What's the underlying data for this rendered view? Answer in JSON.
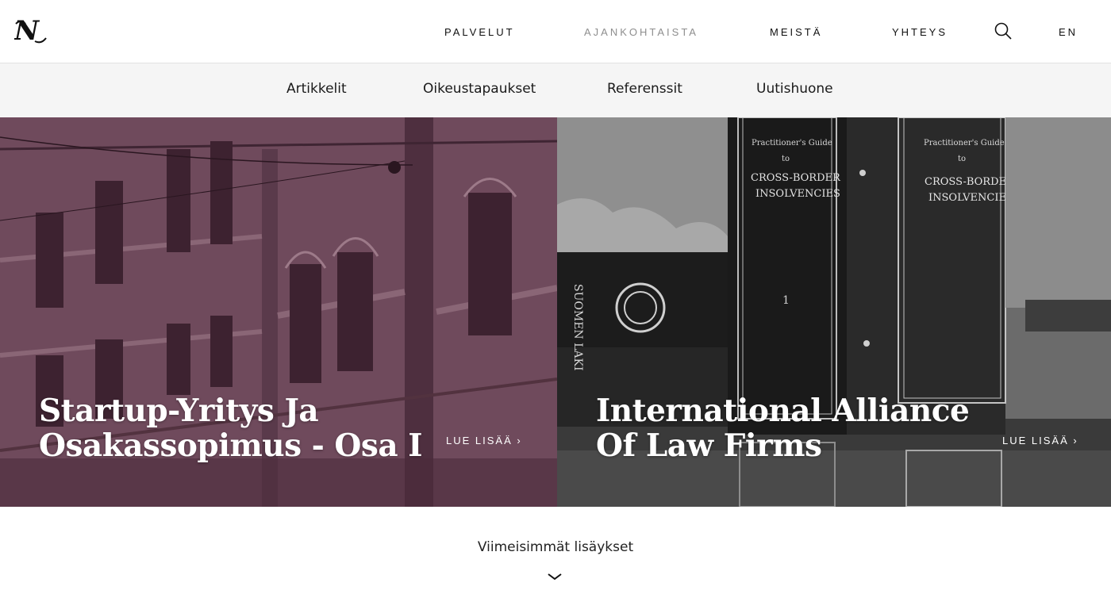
{
  "header": {
    "logo_label": "N",
    "nav": [
      {
        "label": "PALVELUT",
        "active": false
      },
      {
        "label": "AJANKOHTAISTA",
        "active": true
      },
      {
        "label": "MEISTÄ",
        "active": false
      },
      {
        "label": "YHTEYS",
        "active": false
      }
    ],
    "language": "EN",
    "search_icon": "search-icon"
  },
  "subnav": {
    "items": [
      {
        "label": "Artikkelit"
      },
      {
        "label": "Oikeustapaukset"
      },
      {
        "label": "Referenssit"
      },
      {
        "label": "Uutishuone"
      }
    ]
  },
  "hero": {
    "cards": [
      {
        "title_line1": "Startup-Yritys Ja",
        "title_line2": "Osakassopimus - Osa I",
        "read_more": "LUE LISÄÄ ›",
        "overlay_color": "#6a4558"
      },
      {
        "title_line1": "International Alliance",
        "title_line2": "Of Law Firms",
        "read_more": "LUE LISÄÄ ›",
        "book_spine_1": "SUOMEN LAKI",
        "book_label_1": "Practitioner's Guide to CROSS-BORDER INSOLVENCIES",
        "book_label_2": "Practitioner's Guide to CROSS-BORDER INSOLVENCIES"
      }
    ]
  },
  "latest": {
    "label": "Viimeisimmät lisäykset",
    "chevron_icon": "chevron-down-icon"
  },
  "colors": {
    "nav_active": "#8e8e8e",
    "subnav_bg": "#f5f5f5",
    "accent_purple": "#6a4558"
  }
}
